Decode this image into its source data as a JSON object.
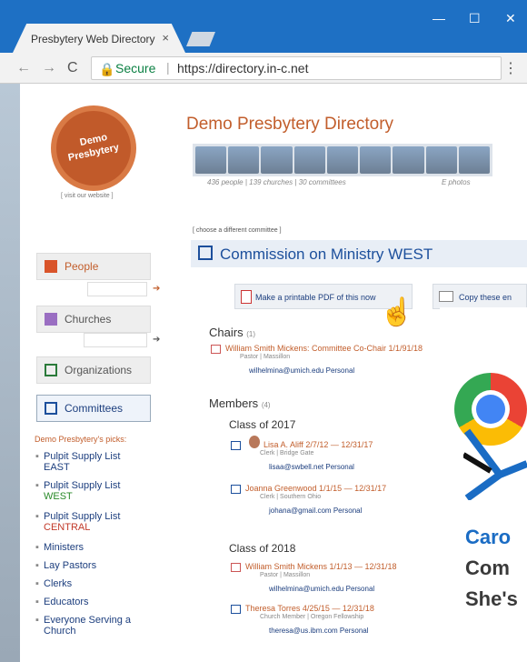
{
  "browser": {
    "tab_title": "Presbytery Web Directory",
    "tab_close": "×",
    "window_min": "—",
    "window_max": "☐",
    "window_close": "✕",
    "nav_back": "←",
    "nav_forward": "→",
    "nav_reload": "C",
    "secure_label": "Secure",
    "url": "https://directory.in-c.net",
    "menu": "⋮"
  },
  "header": {
    "logo_line1": "Demo",
    "logo_line2": "Presbytery",
    "visit_link": "[ visit our website ]",
    "title": "Demo Presbytery Directory",
    "stats": "436 people  |  139 churches  |  30 committees",
    "photos_link": "E photos"
  },
  "sidebar": {
    "people": "People",
    "churches": "Churches",
    "organizations": "Organizations",
    "committees": "Committees",
    "picks_heading": "Demo Presbytery's picks:",
    "picks": [
      {
        "line1": "Pulpit Supply List",
        "line2": "EAST"
      },
      {
        "line1": "Pulpit Supply List",
        "line2": "WEST"
      },
      {
        "line1": "Pulpit Supply List",
        "line2": "CENTRAL"
      },
      {
        "line1": "Ministers",
        "line2": ""
      },
      {
        "line1": "Lay Pastors",
        "line2": ""
      },
      {
        "line1": "Clerks",
        "line2": ""
      },
      {
        "line1": "Educators",
        "line2": ""
      },
      {
        "line1": "Everyone Serving a",
        "line2": "Church"
      }
    ]
  },
  "main": {
    "choose_link": "[ choose a different committee ]",
    "committee_title": "Commission on Ministry WEST",
    "pdf_button": "Make a printable PDF of this now",
    "copy_button": "Copy these en",
    "chairs_heading": "Chairs",
    "chairs_count": "(1)",
    "chairs": [
      {
        "name": "William Smith Mickens:  Committee Co-Chair  1/1/91/18",
        "sub": "Pastor  |  Massillon",
        "email": "wilhelmina@umich.edu  Personal"
      }
    ],
    "members_heading": "Members",
    "members_count": "(4)",
    "class2017": "Class of 2017",
    "class2017_members": [
      {
        "name": "Lisa A. Aliff  2/7/12 — 12/31/17",
        "sub": "Clerk  |  Bridge Gate",
        "email": "lisaa@swbell.net  Personal"
      },
      {
        "name": "Joanna Greenwood  1/1/15 — 12/31/17",
        "sub": "Clerk  |  Southern Ohio",
        "email": "johana@gmail.com  Personal"
      }
    ],
    "class2018": "Class of 2018",
    "class2018_members": [
      {
        "name": "William Smith Mickens  1/1/13 — 12/31/18",
        "sub": "Pastor  |  Massillon",
        "email": "wilhelmina@umich.edu  Personal"
      },
      {
        "name": "Theresa Torres  4/25/15 — 12/31/18",
        "sub": "Church Member  |  Oregon Fellowship",
        "email": "theresa@us.ibm.com  Personal"
      }
    ]
  },
  "promo": {
    "line1": "Caro",
    "line2": "Com",
    "line3": "She's"
  }
}
